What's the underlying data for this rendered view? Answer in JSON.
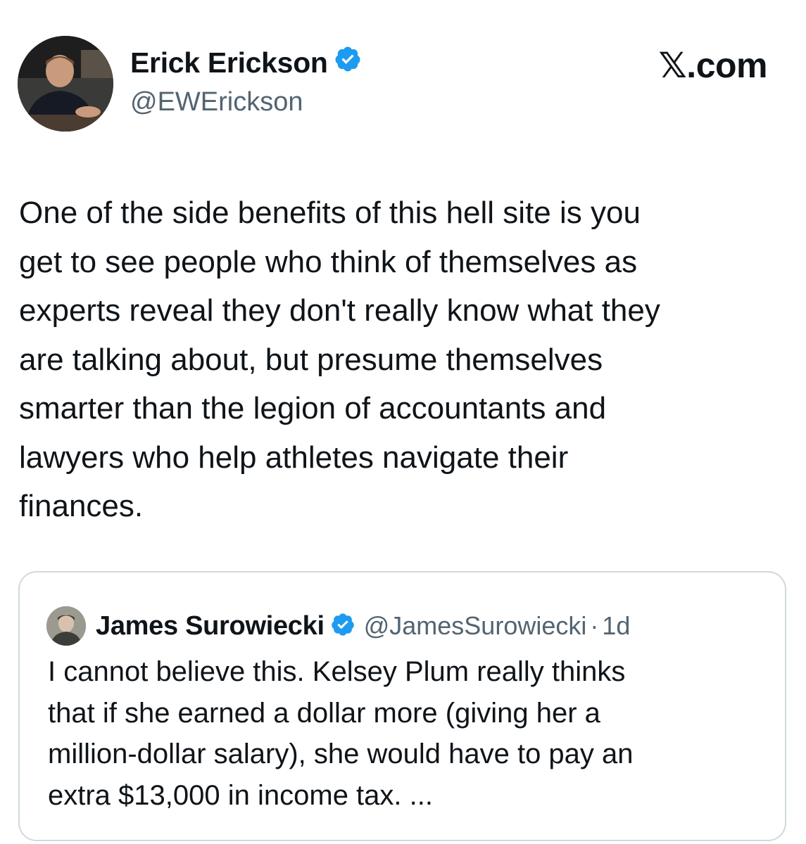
{
  "author": {
    "name": "Erick Erickson",
    "handle": "@EWErickson",
    "verified_icon": "verified-badge-icon",
    "avatar": "author-avatar-photo"
  },
  "brand": {
    "logo_text": ".com",
    "logo_mark": "𝕏"
  },
  "tweet": {
    "lines": [
      "One of the side benefits of this hell site is you",
      "get to see people who think of themselves as",
      "experts reveal they don't really know what they",
      "are talking about, but presume themselves",
      "smarter than the legion of accountants and",
      "lawyers who help athletes navigate their",
      "finances."
    ]
  },
  "quote": {
    "name": "James Surowiecki",
    "handle": "@JamesSurowiecki",
    "separator": "·",
    "time": "1d",
    "verified_icon": "verified-badge-icon",
    "lines": [
      "I cannot believe this. Kelsey Plum really thinks",
      "that if she earned a dollar more (giving her a",
      "million-dollar salary), she would have to pay an",
      "extra $13,000 in income tax. ..."
    ]
  },
  "colors": {
    "text": "#0f1419",
    "secondary": "#536471",
    "verified": "#1d9bf0",
    "border": "#cfd9de"
  }
}
